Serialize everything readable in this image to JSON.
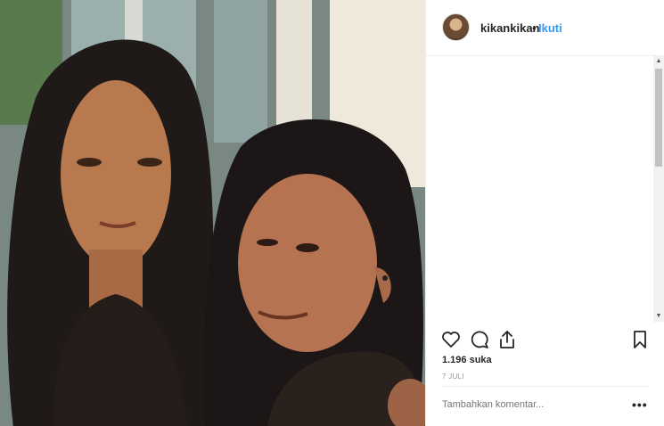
{
  "post": {
    "photo_alt": "",
    "username": "kikankikan",
    "separator": "•",
    "follow_label": "Ikuti",
    "likes": "1.196 suka",
    "date": "7 JULI",
    "comment_placeholder": "Tambahkan komentar...",
    "more_label": "•••"
  },
  "icons": {
    "like": "heart-icon",
    "comment": "comment-icon",
    "share": "share-icon",
    "save": "bookmark-icon"
  },
  "colors": {
    "follow": "#3897f0",
    "text": "#262626",
    "muted": "#999999"
  }
}
